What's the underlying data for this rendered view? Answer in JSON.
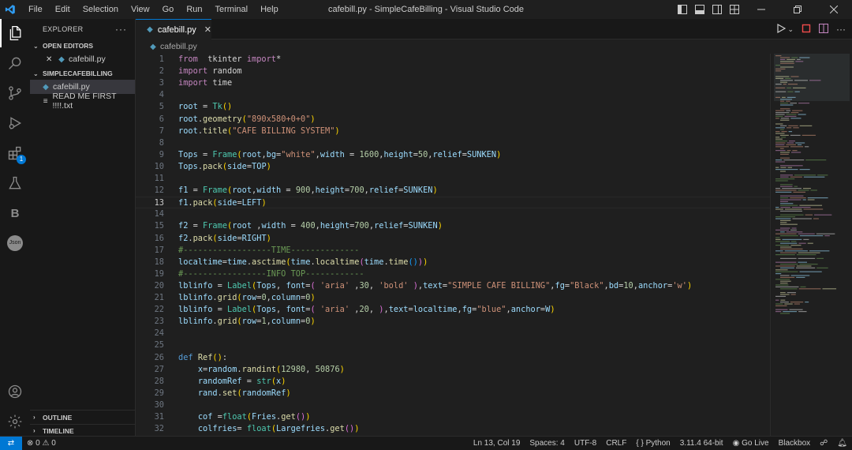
{
  "window": {
    "title": "cafebill.py - SimpleCafeBilling - Visual Studio Code",
    "menu": [
      "File",
      "Edit",
      "Selection",
      "View",
      "Go",
      "Run",
      "Terminal",
      "Help"
    ]
  },
  "sidebar": {
    "header": "EXPLORER",
    "open_editors_label": "OPEN EDITORS",
    "open_editor_file": "cafebill.py",
    "folder_label": "SIMPLECAFEBILLING",
    "files": [
      "cafebill.py",
      "READ ME FIRST !!!!.txt"
    ],
    "outline_label": "OUTLINE",
    "timeline_label": "TIMELINE"
  },
  "activity": {
    "extensions_badge": "1",
    "b_label": "B",
    "json_label": "Json"
  },
  "tab": {
    "label": "cafebill.py"
  },
  "breadcrumb": {
    "file": "cafebill.py"
  },
  "editor": {
    "current_line": 13,
    "lines": [
      {
        "n": "1",
        "t": [
          [
            "k",
            "from"
          ],
          [
            "",
            "  tkinter "
          ],
          [
            "k",
            "import"
          ],
          [
            "",
            "*"
          ]
        ]
      },
      {
        "n": "2",
        "t": [
          [
            "k",
            "import"
          ],
          [
            "",
            " random"
          ]
        ]
      },
      {
        "n": "3",
        "t": [
          [
            "k",
            "import"
          ],
          [
            "",
            " time"
          ]
        ]
      },
      {
        "n": "4",
        "t": []
      },
      {
        "n": "5",
        "t": [
          [
            "v",
            "root"
          ],
          [
            "",
            " = "
          ],
          [
            "c",
            "Tk"
          ],
          [
            "p1",
            "()"
          ]
        ]
      },
      {
        "n": "6",
        "t": [
          [
            "v",
            "root"
          ],
          [
            "",
            "."
          ],
          [
            "f",
            "geometry"
          ],
          [
            "p1",
            "("
          ],
          [
            "s",
            "\"890x580+0+0\""
          ],
          [
            "p1",
            ")"
          ]
        ]
      },
      {
        "n": "7",
        "t": [
          [
            "v",
            "root"
          ],
          [
            "",
            "."
          ],
          [
            "f",
            "title"
          ],
          [
            "p1",
            "("
          ],
          [
            "s",
            "\"CAFE BILLING SYSTEM\""
          ],
          [
            "p1",
            ")"
          ]
        ]
      },
      {
        "n": "8",
        "t": []
      },
      {
        "n": "9",
        "t": [
          [
            "v",
            "Tops"
          ],
          [
            "",
            " = "
          ],
          [
            "c",
            "Frame"
          ],
          [
            "p1",
            "("
          ],
          [
            "v",
            "root"
          ],
          [
            "",
            ","
          ],
          [
            "v",
            "bg"
          ],
          [
            "",
            "="
          ],
          [
            "s",
            "\"white\""
          ],
          [
            "",
            ","
          ],
          [
            "v",
            "width"
          ],
          [
            "",
            " = "
          ],
          [
            "n",
            "1600"
          ],
          [
            "",
            ","
          ],
          [
            "v",
            "height"
          ],
          [
            "",
            "="
          ],
          [
            "n",
            "50"
          ],
          [
            "",
            ","
          ],
          [
            "v",
            "relief"
          ],
          [
            "",
            "="
          ],
          [
            "v",
            "SUNKEN"
          ],
          [
            "p1",
            ")"
          ]
        ]
      },
      {
        "n": "10",
        "t": [
          [
            "v",
            "Tops"
          ],
          [
            "",
            "."
          ],
          [
            "f",
            "pack"
          ],
          [
            "p1",
            "("
          ],
          [
            "v",
            "side"
          ],
          [
            "",
            "="
          ],
          [
            "v",
            "TOP"
          ],
          [
            "p1",
            ")"
          ]
        ]
      },
      {
        "n": "11",
        "t": []
      },
      {
        "n": "12",
        "t": [
          [
            "v",
            "f1"
          ],
          [
            "",
            " = "
          ],
          [
            "c",
            "Frame"
          ],
          [
            "p1",
            "("
          ],
          [
            "v",
            "root"
          ],
          [
            "",
            ","
          ],
          [
            "v",
            "width"
          ],
          [
            "",
            " = "
          ],
          [
            "n",
            "900"
          ],
          [
            "",
            ","
          ],
          [
            "v",
            "height"
          ],
          [
            "",
            "="
          ],
          [
            "n",
            "700"
          ],
          [
            "",
            ","
          ],
          [
            "v",
            "relief"
          ],
          [
            "",
            "="
          ],
          [
            "v",
            "SUNKEN"
          ],
          [
            "p1",
            ")"
          ]
        ]
      },
      {
        "n": "13",
        "t": [
          [
            "v",
            "f1"
          ],
          [
            "",
            "."
          ],
          [
            "f",
            "pack"
          ],
          [
            "p1",
            "("
          ],
          [
            "v",
            "side"
          ],
          [
            "",
            "="
          ],
          [
            "v",
            "LEFT"
          ],
          [
            "p1",
            ")"
          ]
        ]
      },
      {
        "n": "14",
        "t": []
      },
      {
        "n": "15",
        "t": [
          [
            "v",
            "f2"
          ],
          [
            "",
            " = "
          ],
          [
            "c",
            "Frame"
          ],
          [
            "p1",
            "("
          ],
          [
            "v",
            "root"
          ],
          [
            "",
            " ,"
          ],
          [
            "v",
            "width"
          ],
          [
            "",
            " = "
          ],
          [
            "n",
            "400"
          ],
          [
            "",
            ","
          ],
          [
            "v",
            "height"
          ],
          [
            "",
            "="
          ],
          [
            "n",
            "700"
          ],
          [
            "",
            ","
          ],
          [
            "v",
            "relief"
          ],
          [
            "",
            "="
          ],
          [
            "v",
            "SUNKEN"
          ],
          [
            "p1",
            ")"
          ]
        ]
      },
      {
        "n": "16",
        "t": [
          [
            "v",
            "f2"
          ],
          [
            "",
            "."
          ],
          [
            "f",
            "pack"
          ],
          [
            "p1",
            "("
          ],
          [
            "v",
            "side"
          ],
          [
            "",
            "="
          ],
          [
            "v",
            "RIGHT"
          ],
          [
            "p1",
            ")"
          ]
        ]
      },
      {
        "n": "17",
        "t": [
          [
            "cm",
            "#------------------TIME--------------"
          ]
        ]
      },
      {
        "n": "18",
        "t": [
          [
            "v",
            "localtime"
          ],
          [
            "",
            "="
          ],
          [
            "v",
            "time"
          ],
          [
            "",
            "."
          ],
          [
            "f",
            "asctime"
          ],
          [
            "p1",
            "("
          ],
          [
            "v",
            "time"
          ],
          [
            "",
            "."
          ],
          [
            "f",
            "localtime"
          ],
          [
            "p2",
            "("
          ],
          [
            "v",
            "time"
          ],
          [
            "",
            "."
          ],
          [
            "f",
            "time"
          ],
          [
            "p3",
            "()"
          ],
          [
            "p2",
            ")"
          ],
          [
            "p1",
            ")"
          ]
        ]
      },
      {
        "n": "19",
        "t": [
          [
            "cm",
            "#-----------------INFO TOP------------"
          ]
        ]
      },
      {
        "n": "20",
        "t": [
          [
            "v",
            "lblinfo"
          ],
          [
            "",
            " = "
          ],
          [
            "c",
            "Label"
          ],
          [
            "p1",
            "("
          ],
          [
            "v",
            "Tops"
          ],
          [
            "",
            ", "
          ],
          [
            "v",
            "font"
          ],
          [
            "",
            "="
          ],
          [
            "p2",
            "("
          ],
          [
            "",
            " "
          ],
          [
            "s",
            "'aria'"
          ],
          [
            "",
            " ,"
          ],
          [
            "n",
            "30"
          ],
          [
            "",
            ", "
          ],
          [
            "s",
            "'bold'"
          ],
          [
            "",
            " "
          ],
          [
            "p2",
            ")"
          ],
          [
            "",
            ","
          ],
          [
            "v",
            "text"
          ],
          [
            "",
            "="
          ],
          [
            "s",
            "\"SIMPLE CAFE BILLING\""
          ],
          [
            "",
            ","
          ],
          [
            "v",
            "fg"
          ],
          [
            "",
            "="
          ],
          [
            "s",
            "\"Black\""
          ],
          [
            "",
            ","
          ],
          [
            "v",
            "bd"
          ],
          [
            "",
            "="
          ],
          [
            "n",
            "10"
          ],
          [
            "",
            ","
          ],
          [
            "v",
            "anchor"
          ],
          [
            "",
            "="
          ],
          [
            "s",
            "'w'"
          ],
          [
            "p1",
            ")"
          ]
        ]
      },
      {
        "n": "21",
        "t": [
          [
            "v",
            "lblinfo"
          ],
          [
            "",
            "."
          ],
          [
            "f",
            "grid"
          ],
          [
            "p1",
            "("
          ],
          [
            "v",
            "row"
          ],
          [
            "",
            "="
          ],
          [
            "n",
            "0"
          ],
          [
            "",
            ","
          ],
          [
            "v",
            "column"
          ],
          [
            "",
            "="
          ],
          [
            "n",
            "0"
          ],
          [
            "p1",
            ")"
          ]
        ]
      },
      {
        "n": "22",
        "t": [
          [
            "v",
            "lblinfo"
          ],
          [
            "",
            " = "
          ],
          [
            "c",
            "Label"
          ],
          [
            "p1",
            "("
          ],
          [
            "v",
            "Tops"
          ],
          [
            "",
            ", "
          ],
          [
            "v",
            "font"
          ],
          [
            "",
            "="
          ],
          [
            "p2",
            "("
          ],
          [
            "",
            " "
          ],
          [
            "s",
            "'aria'"
          ],
          [
            "",
            " ,"
          ],
          [
            "n",
            "20"
          ],
          [
            "",
            ", "
          ],
          [
            "p2",
            ")"
          ],
          [
            "",
            ","
          ],
          [
            "v",
            "text"
          ],
          [
            "",
            "="
          ],
          [
            "v",
            "localtime"
          ],
          [
            "",
            ","
          ],
          [
            "v",
            "fg"
          ],
          [
            "",
            "="
          ],
          [
            "s",
            "\"blue\""
          ],
          [
            "",
            ","
          ],
          [
            "v",
            "anchor"
          ],
          [
            "",
            "="
          ],
          [
            "v",
            "W"
          ],
          [
            "p1",
            ")"
          ]
        ]
      },
      {
        "n": "23",
        "t": [
          [
            "v",
            "lblinfo"
          ],
          [
            "",
            "."
          ],
          [
            "f",
            "grid"
          ],
          [
            "p1",
            "("
          ],
          [
            "v",
            "row"
          ],
          [
            "",
            "="
          ],
          [
            "n",
            "1"
          ],
          [
            "",
            ","
          ],
          [
            "v",
            "column"
          ],
          [
            "",
            "="
          ],
          [
            "n",
            "0"
          ],
          [
            "p1",
            ")"
          ]
        ]
      },
      {
        "n": "24",
        "t": []
      },
      {
        "n": "25",
        "t": []
      },
      {
        "n": "26",
        "t": [
          [
            "bk",
            "def"
          ],
          [
            "",
            " "
          ],
          [
            "f",
            "Ref"
          ],
          [
            "p1",
            "()"
          ],
          [
            "",
            ":"
          ]
        ]
      },
      {
        "n": "27",
        "t": [
          [
            "",
            "    "
          ],
          [
            "v",
            "x"
          ],
          [
            "",
            "="
          ],
          [
            "v",
            "random"
          ],
          [
            "",
            "."
          ],
          [
            "f",
            "randint"
          ],
          [
            "p1",
            "("
          ],
          [
            "n",
            "12980"
          ],
          [
            "",
            ", "
          ],
          [
            "n",
            "50876"
          ],
          [
            "p1",
            ")"
          ]
        ]
      },
      {
        "n": "28",
        "t": [
          [
            "",
            "    "
          ],
          [
            "v",
            "randomRef"
          ],
          [
            "",
            " = "
          ],
          [
            "c",
            "str"
          ],
          [
            "p1",
            "("
          ],
          [
            "v",
            "x"
          ],
          [
            "p1",
            ")"
          ]
        ]
      },
      {
        "n": "29",
        "t": [
          [
            "",
            "    "
          ],
          [
            "v",
            "rand"
          ],
          [
            "",
            "."
          ],
          [
            "f",
            "set"
          ],
          [
            "p1",
            "("
          ],
          [
            "v",
            "randomRef"
          ],
          [
            "p1",
            ")"
          ]
        ]
      },
      {
        "n": "30",
        "t": []
      },
      {
        "n": "31",
        "t": [
          [
            "",
            "    "
          ],
          [
            "v",
            "cof"
          ],
          [
            "",
            " ="
          ],
          [
            "c",
            "float"
          ],
          [
            "p1",
            "("
          ],
          [
            "v",
            "Fries"
          ],
          [
            "",
            "."
          ],
          [
            "f",
            "get"
          ],
          [
            "p2",
            "()"
          ],
          [
            "p1",
            ")"
          ]
        ]
      },
      {
        "n": "32",
        "t": [
          [
            "",
            "    "
          ],
          [
            "v",
            "colfries"
          ],
          [
            "",
            "= "
          ],
          [
            "c",
            "float"
          ],
          [
            "p1",
            "("
          ],
          [
            "v",
            "Largefries"
          ],
          [
            "",
            "."
          ],
          [
            "f",
            "get"
          ],
          [
            "p2",
            "()"
          ],
          [
            "p1",
            ")"
          ]
        ]
      }
    ]
  },
  "statusbar": {
    "problems": "⊗ 0 ⚠ 0",
    "position": "Ln 13, Col 19",
    "spaces": "Spaces: 4",
    "encoding": "UTF-8",
    "eol": "CRLF",
    "language": "Python",
    "interpreter": "3.11.4 64-bit",
    "golive": "Go Live",
    "blackbox": "Blackbox"
  }
}
